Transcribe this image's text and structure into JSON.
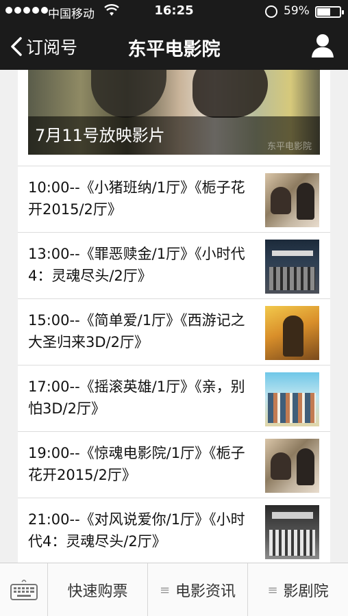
{
  "status_bar": {
    "carrier": "中国移动",
    "time": "16:25",
    "battery": "59%"
  },
  "nav": {
    "back_label": "订阅号",
    "title": "东平电影院"
  },
  "banner": {
    "caption": "7月11号放映影片",
    "watermark": "东平电影院"
  },
  "showtimes": [
    {
      "text": "10:00--《小猪班纳/1厅》《栀子花开2015/2厅》"
    },
    {
      "text": "13:00--《罪恶赎金/1厅》《小时代4：灵魂尽头/2厅》"
    },
    {
      "text": "15:00--《简单爱/1厅》《西游记之大圣归来3D/2厅》"
    },
    {
      "text": "17:00--《摇滚英雄/1厅》《亲，别怕3D/2厅》"
    },
    {
      "text": "19:00--《惊魂电影院/1厅》《栀子花开2015/2厅》"
    },
    {
      "text": "21:00--《对风说爱你/1厅》《小时代4：灵魂尽头/2厅》"
    }
  ],
  "tabbar": {
    "tab1": "快速购票",
    "tab2": "电影资讯",
    "tab3": "影剧院"
  }
}
